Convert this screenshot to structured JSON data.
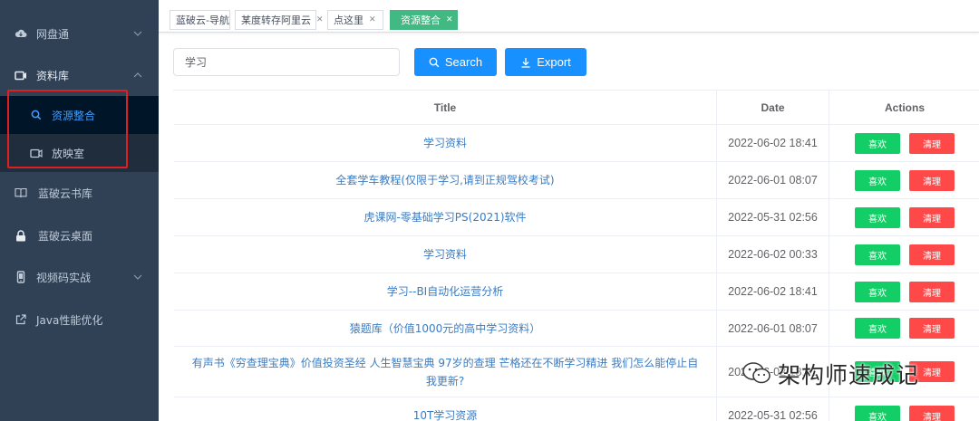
{
  "sidebar": {
    "items": [
      {
        "label": "网盘通",
        "icon": "cloud-icon"
      },
      {
        "label": "资料库",
        "icon": "video-camera-icon"
      },
      {
        "label": "蓝破云书库",
        "icon": "book-icon"
      },
      {
        "label": "蓝破云桌面",
        "icon": "lock-icon"
      },
      {
        "label": "视频码实战",
        "icon": "mobile-icon"
      },
      {
        "label": "Java性能优化",
        "icon": "external-link-icon"
      }
    ],
    "submenu": [
      {
        "label": "资源整合",
        "icon": "search-icon",
        "active": true
      },
      {
        "label": "放映室",
        "icon": "video-camera-icon",
        "active": false
      }
    ]
  },
  "tags": [
    {
      "label": "蓝破云-导航"
    },
    {
      "label": "某度转存阿里云"
    },
    {
      "label": "点这里"
    },
    {
      "label": "资源整合",
      "active": true
    }
  ],
  "search": {
    "value": "学习"
  },
  "toolbar": {
    "search_label": "Search",
    "export_label": "Export"
  },
  "table": {
    "headers": {
      "title": "Title",
      "date": "Date",
      "actions": "Actions"
    },
    "like_label": "喜欢",
    "clean_label": "清理",
    "rows": [
      {
        "title": "学习资料",
        "date": "2022-06-02 18:41"
      },
      {
        "title": "全套学车教程(仅限于学习,请到正规驾校考试)",
        "date": "2022-06-01 08:07"
      },
      {
        "title": "虎课网-零基础学习PS(2021)软件",
        "date": "2022-05-31 02:56"
      },
      {
        "title": "学习资料",
        "date": "2022-06-02 00:33"
      },
      {
        "title": "学习--BI自动化运营分析",
        "date": "2022-06-02 18:41"
      },
      {
        "title": "猿题库（价值1000元的高中学习资料）",
        "date": "2022-06-01 08:07"
      },
      {
        "title": "有声书《穷查理宝典》价值投资圣经 人生智慧宝典 97岁的查理 芒格还在不断学习精进 我们怎么能停止自我更新?",
        "date": "2022-06-02 18:41"
      },
      {
        "title": "10T学习资源",
        "date": "2022-05-31 02:56"
      }
    ]
  },
  "watermark": {
    "text": "架构师速成记"
  },
  "colors": {
    "sidebar": "#304156",
    "primary": "#1890ff",
    "success": "#13ce66",
    "danger": "#ff4949",
    "tag_active": "#42b983",
    "highlight_box": "#e02020"
  }
}
